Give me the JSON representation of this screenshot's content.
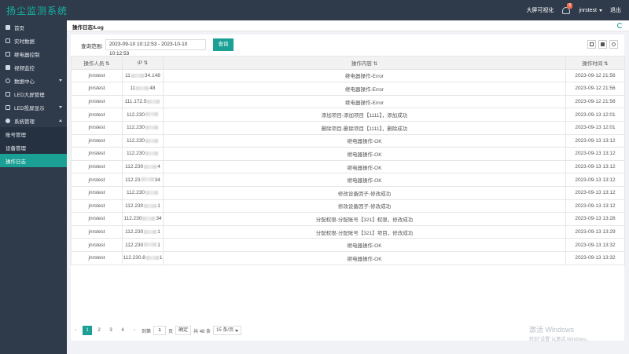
{
  "app": {
    "title": "扬尘监测系统",
    "big_screen_label": "大屏可视化",
    "notify_count": "5",
    "username": "jnrstest",
    "logout_label": "退出"
  },
  "sidebar": {
    "items": [
      {
        "label": "首页"
      },
      {
        "label": "实时数据"
      },
      {
        "label": "继电器控制"
      },
      {
        "label": "视频监控"
      },
      {
        "label": "数据中心"
      },
      {
        "label": "LED大屏管理"
      },
      {
        "label": "LED投屏显示"
      },
      {
        "label": "系统管理"
      }
    ],
    "sub_items": [
      {
        "label": "账号管理"
      },
      {
        "label": "设备管理"
      },
      {
        "label": "操作日志"
      }
    ]
  },
  "breadcrumb": "操作日志/Log",
  "search": {
    "label": "查询范围:",
    "date_range": "2023-09-10 10:12:53 - 2023-10-10 10:12:53",
    "button": "查询"
  },
  "table": {
    "headers": [
      "操作人员 ⇅",
      "IP ⇅",
      "操作内容 ⇅",
      "操作时间 ⇅"
    ],
    "rows": [
      {
        "user": "jnrstest",
        "ip_pre": "11",
        "ip_post": "34.148",
        "content": "继电器操作-Error",
        "time": "2023-09-12 21:56"
      },
      {
        "user": "jnrstest",
        "ip_pre": "11",
        "ip_post": "48",
        "content": "继电器操作-Error",
        "time": "2023-09-12 21:56"
      },
      {
        "user": "jnrstest",
        "ip_pre": "111.172.5",
        "ip_post": "",
        "content": "继电器操作-Error",
        "time": "2023-09-12 21:56"
      },
      {
        "user": "jnrstest",
        "ip_pre": "112.230",
        "ip_post": "",
        "content": "添加项目-添加项目【1111】，添加成功",
        "time": "2023-09-13 12:01"
      },
      {
        "user": "jnrstest",
        "ip_pre": "112.230",
        "ip_post": "",
        "content": "删除项目-删除项目【1111】，删除成功",
        "time": "2023-09-13 12:01"
      },
      {
        "user": "jnrstest",
        "ip_pre": "112.230",
        "ip_post": "",
        "content": "继电器操作-OK",
        "time": "2023-09-13 13:12"
      },
      {
        "user": "jnrstest",
        "ip_pre": "112.230",
        "ip_post": "",
        "content": "继电器操作-OK",
        "time": "2023-09-13 13:12"
      },
      {
        "user": "jnrstest",
        "ip_pre": "112.230",
        "ip_post": "4",
        "content": "继电器操作-OK",
        "time": "2023-09-13 13:12"
      },
      {
        "user": "jnrstest",
        "ip_pre": "112.23",
        "ip_post": "34",
        "content": "继电器操作-OK",
        "time": "2023-09-13 13:12"
      },
      {
        "user": "jnrstest",
        "ip_pre": "112.230",
        "ip_post": "",
        "content": "修改设备因子-修改成功",
        "time": "2023-09-13 13:12"
      },
      {
        "user": "jnrstest",
        "ip_pre": "112.230",
        "ip_post": "1",
        "content": "修改设备因子-修改成功",
        "time": "2023-09-13 13:12"
      },
      {
        "user": "jnrstest",
        "ip_pre": "112.230",
        "ip_post": "34",
        "content": "分配权限-分配账号【321】权限，修改成功",
        "time": "2023-09-13 13:28"
      },
      {
        "user": "jnrstest",
        "ip_pre": "112.230",
        "ip_post": "1",
        "content": "分配权限-分配账号【321】项目，修改成功",
        "time": "2023-09-13 13:29"
      },
      {
        "user": "jnrstest",
        "ip_pre": "112.230",
        "ip_post": "1",
        "content": "继电器操作-OK",
        "time": "2023-09-13 13:32"
      },
      {
        "user": "jnrstest",
        "ip_pre": "112.230.8",
        "ip_post": "1",
        "content": "继电器操作-OK",
        "time": "2023-09-13 13:32"
      }
    ]
  },
  "pager": {
    "pages": [
      "1",
      "2",
      "3",
      "4"
    ],
    "goto_label": "到第",
    "goto_value": "1",
    "page_unit": "页",
    "ok_label": "确定",
    "total_label": "共 48 条",
    "page_size": "15 条/页"
  },
  "watermark": {
    "line1": "激活 Windows",
    "line2": "转到\"设置\"以激活 Windows。"
  }
}
